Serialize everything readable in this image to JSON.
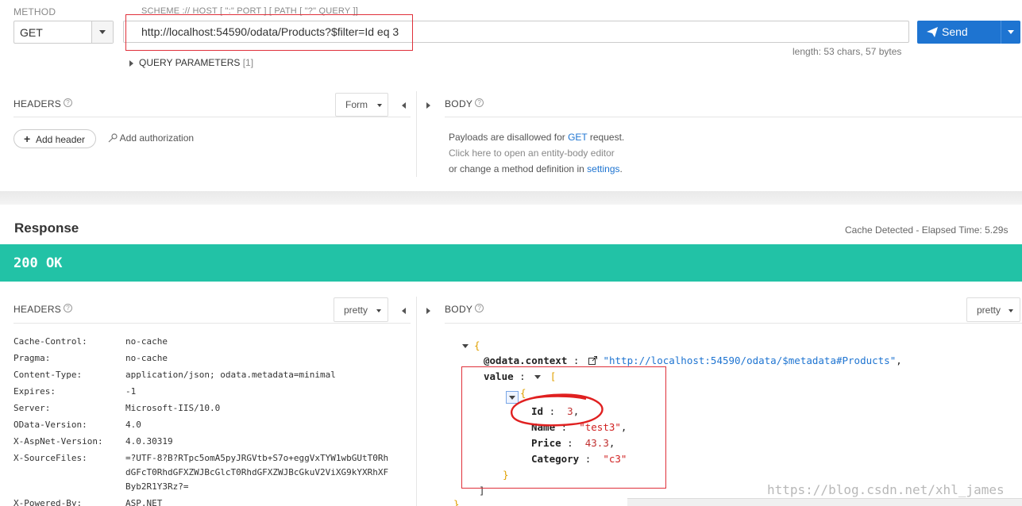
{
  "request": {
    "method_label": "METHOD",
    "method_value": "GET",
    "scheme_label": "SCHEME :// HOST [ \":\" PORT ] [ PATH [ \"?\" QUERY ]]",
    "url": "http://localhost:54590/odata/Products?$filter=Id eq 3",
    "send_label": "Send",
    "length_text": "length: 53 chars, 57 bytes",
    "query_params_label": "QUERY PARAMETERS",
    "query_params_count": "[1]"
  },
  "req_headers": {
    "title": "HEADERS",
    "mode": "Form",
    "add_header": "Add header",
    "add_auth": "Add authorization"
  },
  "req_body": {
    "title": "BODY",
    "line1_pre": "Payloads are disallowed for",
    "line1_method": "GET",
    "line1_post": "request.",
    "line2": "Click here to open an entity-body editor",
    "line3_pre": "or change a method definition in",
    "line3_link": "settings",
    "line3_post": "."
  },
  "response": {
    "title": "Response",
    "cache_info": "Cache Detected - Elapsed Time: 5.29s",
    "status": "200 OK",
    "status_color": "#22c2a6",
    "headers_title": "HEADERS",
    "headers_mode": "pretty",
    "body_title": "BODY",
    "body_mode": "pretty",
    "headers": [
      {
        "name": "Cache-Control:",
        "value": "no-cache"
      },
      {
        "name": "Pragma:",
        "value": "no-cache"
      },
      {
        "name": "Content-Type:",
        "value": "application/json; odata.metadata=minimal"
      },
      {
        "name": "Expires:",
        "value": "-1"
      },
      {
        "name": "Server:",
        "value": "Microsoft-IIS/10.0"
      },
      {
        "name": "OData-Version:",
        "value": "4.0"
      },
      {
        "name": "X-AspNet-Version:",
        "value": "4.0.30319"
      },
      {
        "name": "X-SourceFiles:",
        "value": "=?UTF-8?B?RTpc5omA5pyJRGVtb+S7o+eggVxTYW1wbGUtT0Rh"
      },
      {
        "name": "",
        "value": "dGFcT0RhdGFXZWJBcGlcT0RhdGFXZWJBcGkuV2ViXG9kYXRhXF"
      },
      {
        "name": "",
        "value": "Byb2R1Y3Rz?="
      },
      {
        "name": "X-Powered-By:",
        "value": "ASP.NET"
      }
    ],
    "json": {
      "open_brace": "{",
      "context_key": "@odata.context",
      "context_value": "\"http://localhost:54590/odata/$metadata#Products\"",
      "value_key": "value",
      "open_bracket": "[",
      "item_open": "{",
      "id_key": "Id",
      "id_value": "3",
      "name_key": "Name",
      "name_value": "\"test3\"",
      "price_key": "Price",
      "price_value": "43.3",
      "category_key": "Category",
      "category_value": "\"c3\"",
      "item_close": "}",
      "close_bracket": "]",
      "close_brace": "}"
    }
  },
  "watermark": "https://blog.csdn.net/xhl_james"
}
